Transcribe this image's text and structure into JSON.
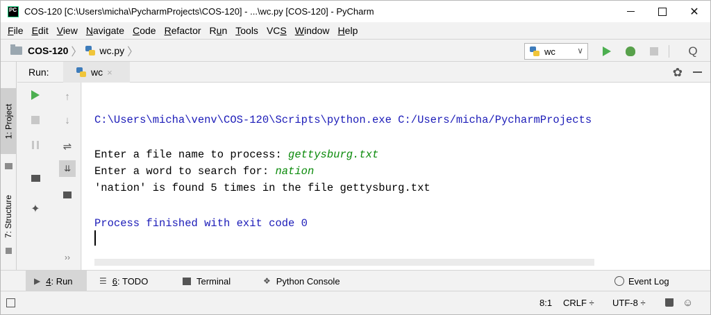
{
  "window": {
    "title": "COS-120 [C:\\Users\\micha\\PycharmProjects\\COS-120] - ...\\wc.py [COS-120] - PyCharm",
    "app_icon_text": "PC",
    "close_glyph": "✕"
  },
  "menu": [
    {
      "mnemonic": "F",
      "rest": "ile"
    },
    {
      "mnemonic": "E",
      "rest": "dit"
    },
    {
      "mnemonic": "V",
      "rest": "iew"
    },
    {
      "mnemonic": "N",
      "rest": "avigate"
    },
    {
      "mnemonic": "C",
      "rest": "ode"
    },
    {
      "mnemonic": "R",
      "rest": "efactor"
    },
    {
      "pre": "R",
      "mnemonic": "u",
      "rest": "n"
    },
    {
      "mnemonic": "T",
      "rest": "ools"
    },
    {
      "pre": "VC",
      "mnemonic": "S",
      "rest": ""
    },
    {
      "mnemonic": "W",
      "rest": "indow"
    },
    {
      "mnemonic": "H",
      "rest": "elp"
    }
  ],
  "navbar": {
    "project": "COS-120",
    "file": "wc.py",
    "separator": "〉",
    "run_config": "wc",
    "run_config_chevron": "∨",
    "search_glyph": "Q"
  },
  "side": {
    "project_tab": "1: Project",
    "structure_tab": "7: Structure"
  },
  "run_panel": {
    "label": "Run:",
    "tab_label": "wc",
    "tab_close": "×",
    "gear_glyph": "✿"
  },
  "gutter": {
    "up_arrow": "↑",
    "down_arrow": "↓",
    "wrap_glyph": "⇌",
    "scroll_glyph": "⇊",
    "pin_glyph": "✦",
    "more_glyph": "››"
  },
  "console": {
    "command": "C:\\Users\\micha\\venv\\COS-120\\Scripts\\python.exe C:/Users/micha/PycharmProjects",
    "prompt1": "Enter a file name to process: ",
    "input1": "gettysburg.txt",
    "prompt2": "Enter a word to search for: ",
    "input2": "nation",
    "result": "'nation' is found 5 times in the file gettysburg.txt",
    "exit": "Process finished with exit code 0"
  },
  "bottom_tabs": {
    "run_mnemonic": "4",
    "run_rest": ": Run",
    "todo_mnemonic": "6",
    "todo_rest": ": TODO",
    "terminal": "Terminal",
    "python_console": "Python Console",
    "event_log": "Event Log",
    "run_glyph": "▶",
    "todo_glyph": "☰",
    "pyconsole_glyph": "❖"
  },
  "status": {
    "position": "8:1",
    "line_sep": "CRLF ÷",
    "encoding": "UTF-8 ÷",
    "inspector_glyph": "☺"
  }
}
